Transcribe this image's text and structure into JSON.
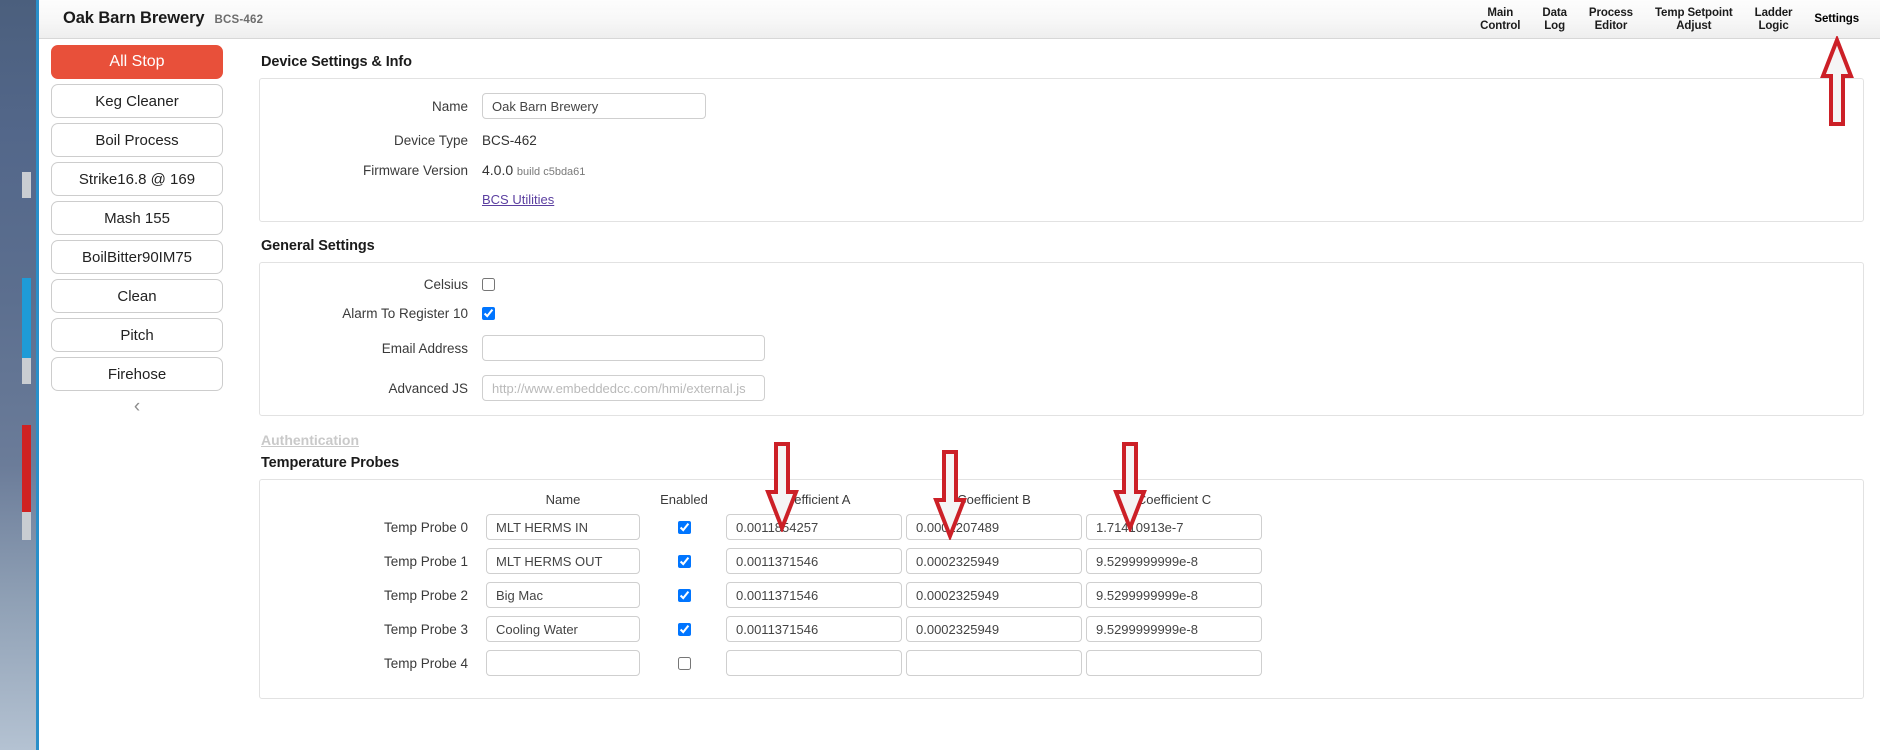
{
  "header": {
    "brand_title": "Oak Barn Brewery",
    "brand_model": "BCS-462",
    "nav": [
      {
        "label": "Main\nControl",
        "name": "nav-main-control"
      },
      {
        "label": "Data\nLog",
        "name": "nav-data-log"
      },
      {
        "label": "Process\nEditor",
        "name": "nav-process-editor"
      },
      {
        "label": "Temp Setpoint\nAdjust",
        "name": "nav-temp-setpoint-adjust"
      },
      {
        "label": "Ladder\nLogic",
        "name": "nav-ladder-logic"
      },
      {
        "label": "Settings",
        "name": "nav-settings"
      }
    ]
  },
  "sidebar": {
    "buttons": [
      {
        "label": "All Stop",
        "style": "stop"
      },
      {
        "label": "Keg Cleaner",
        "style": "normal"
      },
      {
        "label": "Boil Process",
        "style": "normal"
      },
      {
        "label": "Strike16.8 @ 169",
        "style": "normal"
      },
      {
        "label": "Mash 155",
        "style": "normal"
      },
      {
        "label": "BoilBitter90IM75",
        "style": "normal"
      },
      {
        "label": "Clean",
        "style": "normal"
      },
      {
        "label": "Pitch",
        "style": "normal"
      },
      {
        "label": "Firehose",
        "style": "normal"
      }
    ],
    "collapse_icon": "‹"
  },
  "device_settings": {
    "section_title": "Device Settings & Info",
    "name_label": "Name",
    "name_value": "Oak Barn Brewery",
    "device_type_label": "Device Type",
    "device_type_value": "BCS-462",
    "firmware_label": "Firmware Version",
    "firmware_version": "4.0.0",
    "firmware_build": "build c5bda61",
    "utilities_link": "BCS Utilities"
  },
  "general_settings": {
    "section_title": "General Settings",
    "celsius_label": "Celsius",
    "celsius_checked": false,
    "alarm_label": "Alarm To Register 10",
    "alarm_checked": true,
    "email_label": "Email Address",
    "email_value": "",
    "email_placeholder": "",
    "advanced_js_label": "Advanced JS",
    "advanced_js_value": "",
    "advanced_js_placeholder": "http://www.embeddedcc.com/hmi/external.js"
  },
  "authentication": {
    "link_label": "Authentication"
  },
  "temperature_probes": {
    "section_title": "Temperature Probes",
    "columns": [
      "",
      "Name",
      "Enabled",
      "Coefficient A",
      "Coefficient B",
      "Coefficient C"
    ],
    "rows": [
      {
        "label": "Temp Probe 0",
        "name": "MLT HERMS IN",
        "enabled": true,
        "coef_a": "0.0011854257",
        "coef_b": "0.0002207489",
        "coef_c": "1.71410913e-7"
      },
      {
        "label": "Temp Probe 1",
        "name": "MLT HERMS OUT",
        "enabled": true,
        "coef_a": "0.0011371546",
        "coef_b": "0.0002325949",
        "coef_c": "9.5299999999e-8"
      },
      {
        "label": "Temp Probe 2",
        "name": "Big Mac",
        "enabled": true,
        "coef_a": "0.0011371546",
        "coef_b": "0.0002325949",
        "coef_c": "9.5299999999e-8"
      },
      {
        "label": "Temp Probe 3",
        "name": "Cooling Water",
        "enabled": true,
        "coef_a": "0.0011371546",
        "coef_b": "0.0002325949",
        "coef_c": "9.5299999999e-8"
      },
      {
        "label": "Temp Probe 4",
        "name": "",
        "enabled": false,
        "coef_a": "",
        "coef_b": "",
        "coef_c": ""
      }
    ]
  },
  "annotations": {
    "arrow_color": "#cc2027",
    "arrows": [
      {
        "name": "arrow-settings-tab",
        "direction": "up"
      },
      {
        "name": "arrow-coefficient-a",
        "direction": "down"
      },
      {
        "name": "arrow-coefficient-b",
        "direction": "down"
      },
      {
        "name": "arrow-coefficient-c",
        "direction": "down"
      }
    ]
  }
}
